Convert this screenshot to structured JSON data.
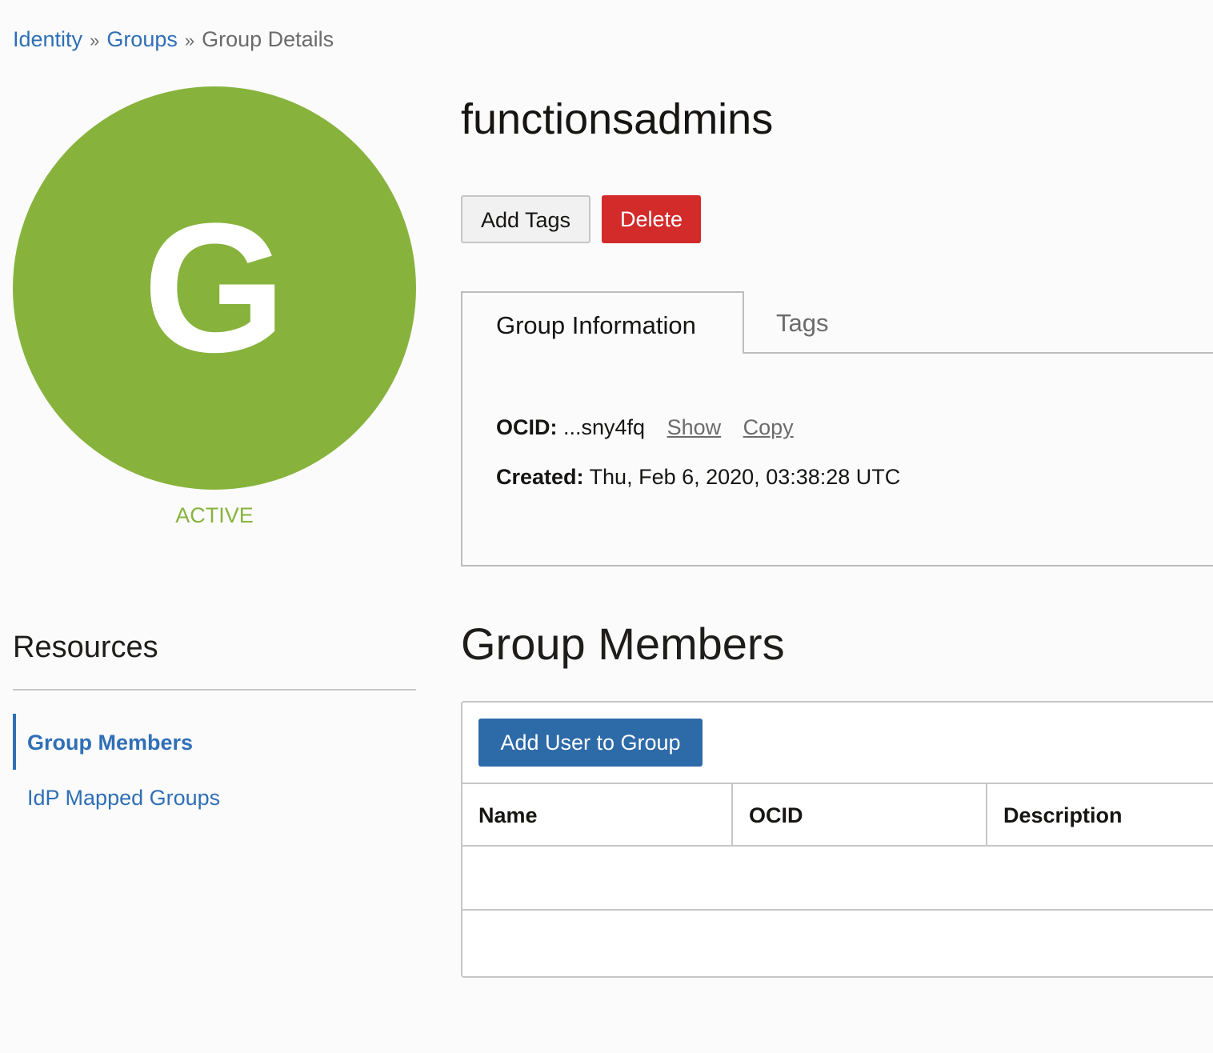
{
  "breadcrumb": {
    "items": [
      {
        "label": "Identity"
      },
      {
        "label": "Groups"
      }
    ],
    "separator": "»",
    "current": "Group Details"
  },
  "avatar": {
    "letter": "G",
    "color": "#87b33d"
  },
  "status": "ACTIVE",
  "resources": {
    "title": "Resources",
    "items": [
      {
        "label": "Group Members",
        "active": true
      },
      {
        "label": "IdP Mapped Groups",
        "active": false
      }
    ]
  },
  "group": {
    "name": "functionsadmins"
  },
  "actions": {
    "add_tags": "Add Tags",
    "delete": "Delete"
  },
  "tabs": [
    {
      "label": "Group Information",
      "active": true
    },
    {
      "label": "Tags",
      "active": false
    }
  ],
  "info": {
    "ocid_label": "OCID:",
    "ocid_value": "...sny4fq",
    "show_link": "Show",
    "copy_link": "Copy",
    "created_label": "Created:",
    "created_value": "Thu, Feb 6, 2020, 03:38:28 UTC"
  },
  "members": {
    "title": "Group Members",
    "add_button": "Add User to Group",
    "columns": [
      "Name",
      "OCID",
      "Description"
    ],
    "rows": []
  },
  "colors": {
    "link": "#2f6fb6",
    "active_status": "#87b33d",
    "delete": "#d32a2a",
    "primary_button": "#2d6aa8"
  }
}
